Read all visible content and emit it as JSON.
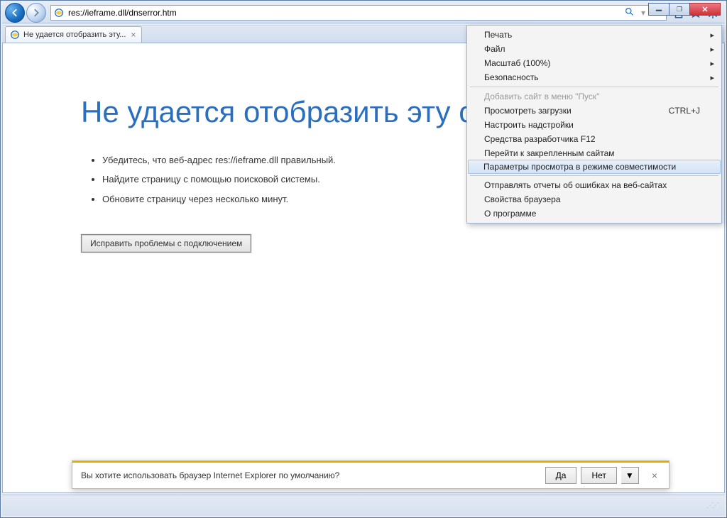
{
  "window": {
    "tab_title": "Не удается отобразить эту...",
    "url": "res://ieframe.dll/dnserror.htm"
  },
  "error_page": {
    "title": "Не удается отобразить эту страницу",
    "bullets": [
      "Убедитесь, что веб-адрес res://ieframe.dll правильный.",
      "Найдите страницу с помощью поисковой системы.",
      "Обновите страницу через несколько минут."
    ],
    "fix_button": "Исправить проблемы с подключением"
  },
  "tools_menu": {
    "items": [
      {
        "label": "Печать",
        "sub": true
      },
      {
        "label": "Файл",
        "sub": true
      },
      {
        "label": "Масштаб (100%)",
        "sub": true
      },
      {
        "label": "Безопасность",
        "sub": true
      }
    ],
    "disabled_item": "Добавить сайт в меню \"Пуск\"",
    "items2": [
      {
        "label": "Просмотреть загрузки",
        "shortcut": "CTRL+J"
      },
      {
        "label": "Настроить надстройки"
      },
      {
        "label": "Средства разработчика F12"
      },
      {
        "label": "Перейти к закрепленным сайтам"
      }
    ],
    "highlight": "Параметры просмотра в режиме совместимости",
    "items3": [
      {
        "label": "Отправлять отчеты об ошибках на веб-сайтах"
      },
      {
        "label": "Свойства браузера"
      },
      {
        "label": "О программе"
      }
    ]
  },
  "infobar": {
    "message": "Вы хотите использовать браузер Internet Explorer по умолчанию?",
    "yes": "Да",
    "no": "Нет"
  }
}
